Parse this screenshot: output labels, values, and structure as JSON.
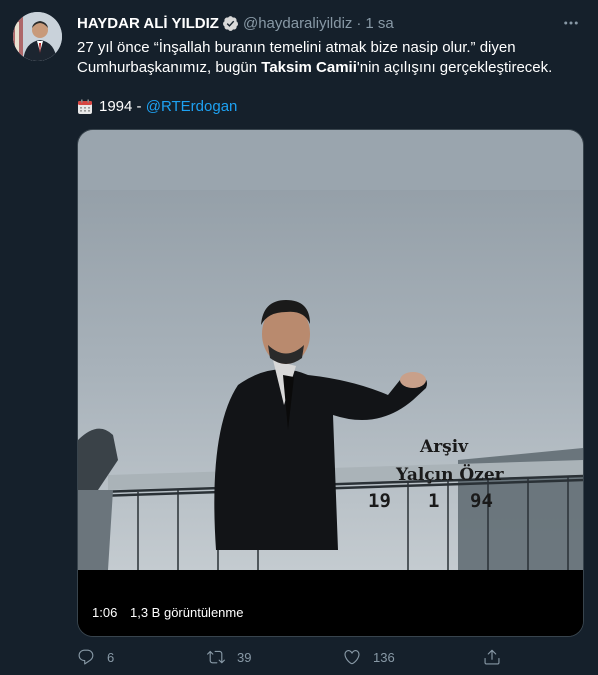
{
  "tweet": {
    "author_name": "HAYDAR ALİ YILDIZ",
    "author_handle": "@haydaraliyildiz",
    "separator": "·",
    "timestamp": "1 sa",
    "text_part1": "27 yıl önce “İnşallah buranın temelini atmak bize nasip olur.” diyen Cumhurbaşkanımız, bugün ",
    "text_bold1": "Taksim Camii",
    "text_part2": "'nin açılışını gerçekleştirecek.",
    "year_text": "1994",
    "dash": " - ",
    "mention": "@RTErdogan"
  },
  "video": {
    "duration": "1:06",
    "views": "1,3 B görüntülenme",
    "overlay_line1": "Arşiv",
    "overlay_line2": "Yalçın Özer",
    "overlay_date_day": "19",
    "overlay_date_month": "1",
    "overlay_date_year": "94"
  },
  "actions": {
    "reply_count": "6",
    "retweet_count": "39",
    "like_count": "136"
  },
  "icons": {
    "verified": "verified-badge-icon",
    "more": "more-icon",
    "calendar": "calendar-icon",
    "reply": "reply-icon",
    "retweet": "retweet-icon",
    "like": "like-icon",
    "share": "share-icon"
  },
  "colors": {
    "background": "#15202b",
    "link": "#1da1f2",
    "muted": "#8899a6",
    "border": "#38444d"
  }
}
